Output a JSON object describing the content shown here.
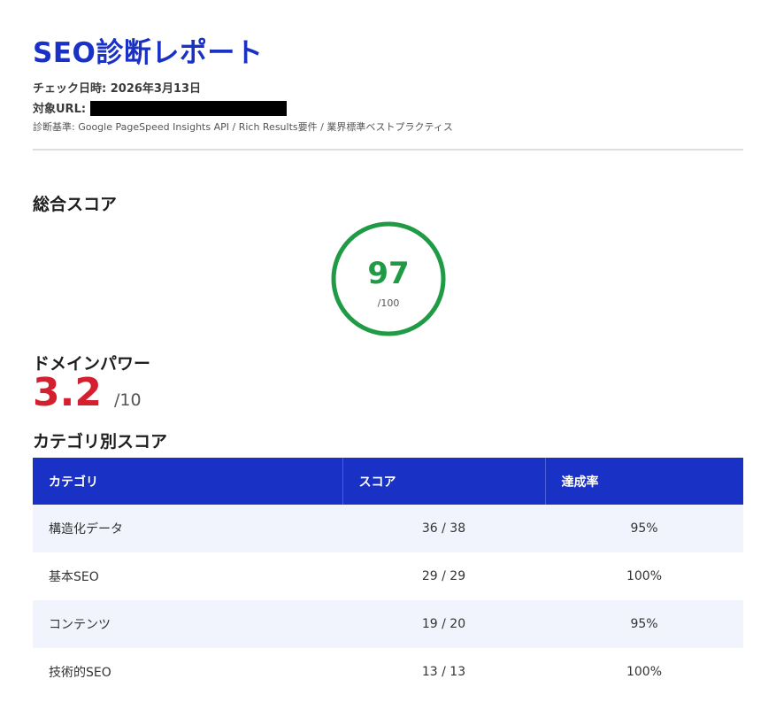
{
  "header": {
    "title": "SEO診断レポート",
    "check_date_label": "チェック日時:",
    "check_date_value": "2026年3月13日",
    "target_url_label": "対象URL:",
    "basis_text": "診断基準: Google PageSpeed Insights API / Rich Results要件 / 業界標準ベストプラクティス"
  },
  "total_score": {
    "heading": "総合スコア",
    "value": "97",
    "max_label": "/100",
    "progress_fraction": 1.0,
    "color": "#1f9b45"
  },
  "domain_power": {
    "heading": "ドメインパワー",
    "value": "3.2",
    "max_label": "/10",
    "color": "#d41f2f"
  },
  "category_scores": {
    "heading": "カテゴリ別スコア",
    "columns": [
      "カテゴリ",
      "スコア",
      "達成率"
    ],
    "rows": [
      {
        "category": "構造化データ",
        "score": "36 / 38",
        "rate": "95%"
      },
      {
        "category": "基本SEO",
        "score": "29 / 29",
        "rate": "100%"
      },
      {
        "category": "コンテンツ",
        "score": "19 / 20",
        "rate": "95%"
      },
      {
        "category": "技術的SEO",
        "score": "13 / 13",
        "rate": "100%"
      }
    ]
  },
  "colors": {
    "brand_blue": "#1a31c6",
    "score_green": "#1f9b45",
    "alert_red": "#d41f2f",
    "row_stripe": "#f1f4fd"
  }
}
